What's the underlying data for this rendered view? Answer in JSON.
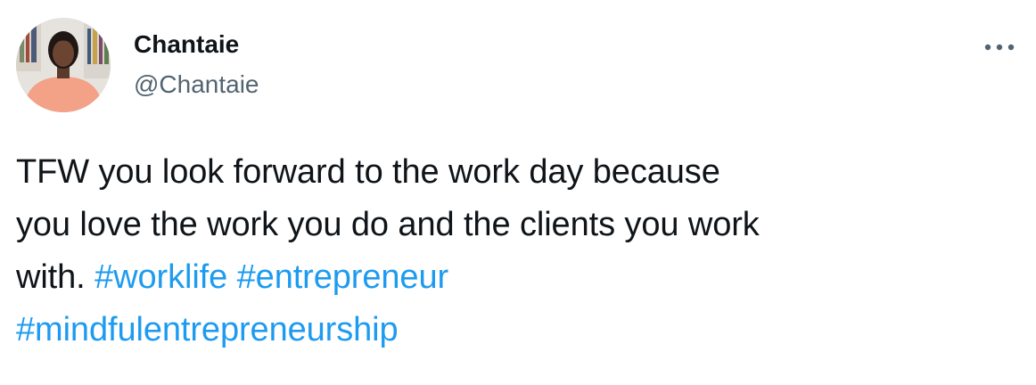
{
  "author": {
    "display_name": "Chantaie",
    "handle": "@Chantaie",
    "avatar_icon": "profile-photo"
  },
  "actions": {
    "more_icon": "more-horizontal-icon"
  },
  "tweet": {
    "text_line_1": "TFW you look forward to the work day because",
    "text_line_2": "you love the work you do and the clients you work",
    "text_line_3_prefix": "with.",
    "hashtags": [
      "#worklife",
      "#entrepreneur",
      "#mindfulentrepreneurship"
    ]
  },
  "colors": {
    "text": "#0f1419",
    "secondary": "#536471",
    "link": "#1d9bf0",
    "background": "#ffffff"
  }
}
